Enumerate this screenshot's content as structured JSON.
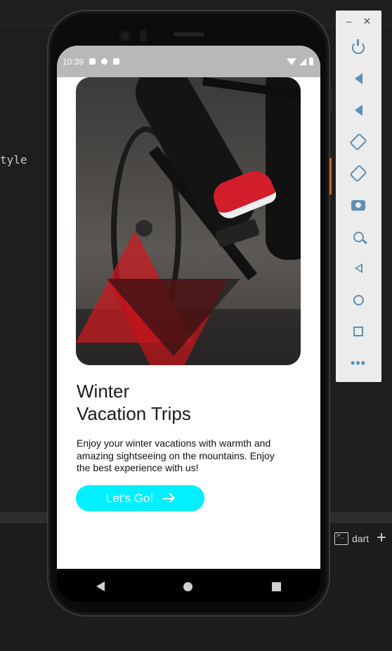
{
  "ide": {
    "code_fragment": "tyle",
    "terminal_tab_label": "dart",
    "add_terminal_glyph": "+"
  },
  "statusbar": {
    "time": "10:39"
  },
  "hero": {
    "image_description_icon": "cyclist-photo"
  },
  "content": {
    "title_line1": "Winter",
    "title_line2": "Vacation Trips",
    "description": "Enjoy your winter vacations with warmth and amazing sightseeing on the mountains. Enjoy the best experience with us!",
    "cta_label": "Let's Go!"
  },
  "emulator": {
    "minimize_glyph": "–",
    "close_glyph": "✕",
    "more_glyph": "•••"
  },
  "colors": {
    "accent_cyan": "#00f0ff",
    "ide_bg": "#1e1e1e",
    "status_bar": "#b8b8b8",
    "emulator_icons": "#5f8fb3"
  }
}
